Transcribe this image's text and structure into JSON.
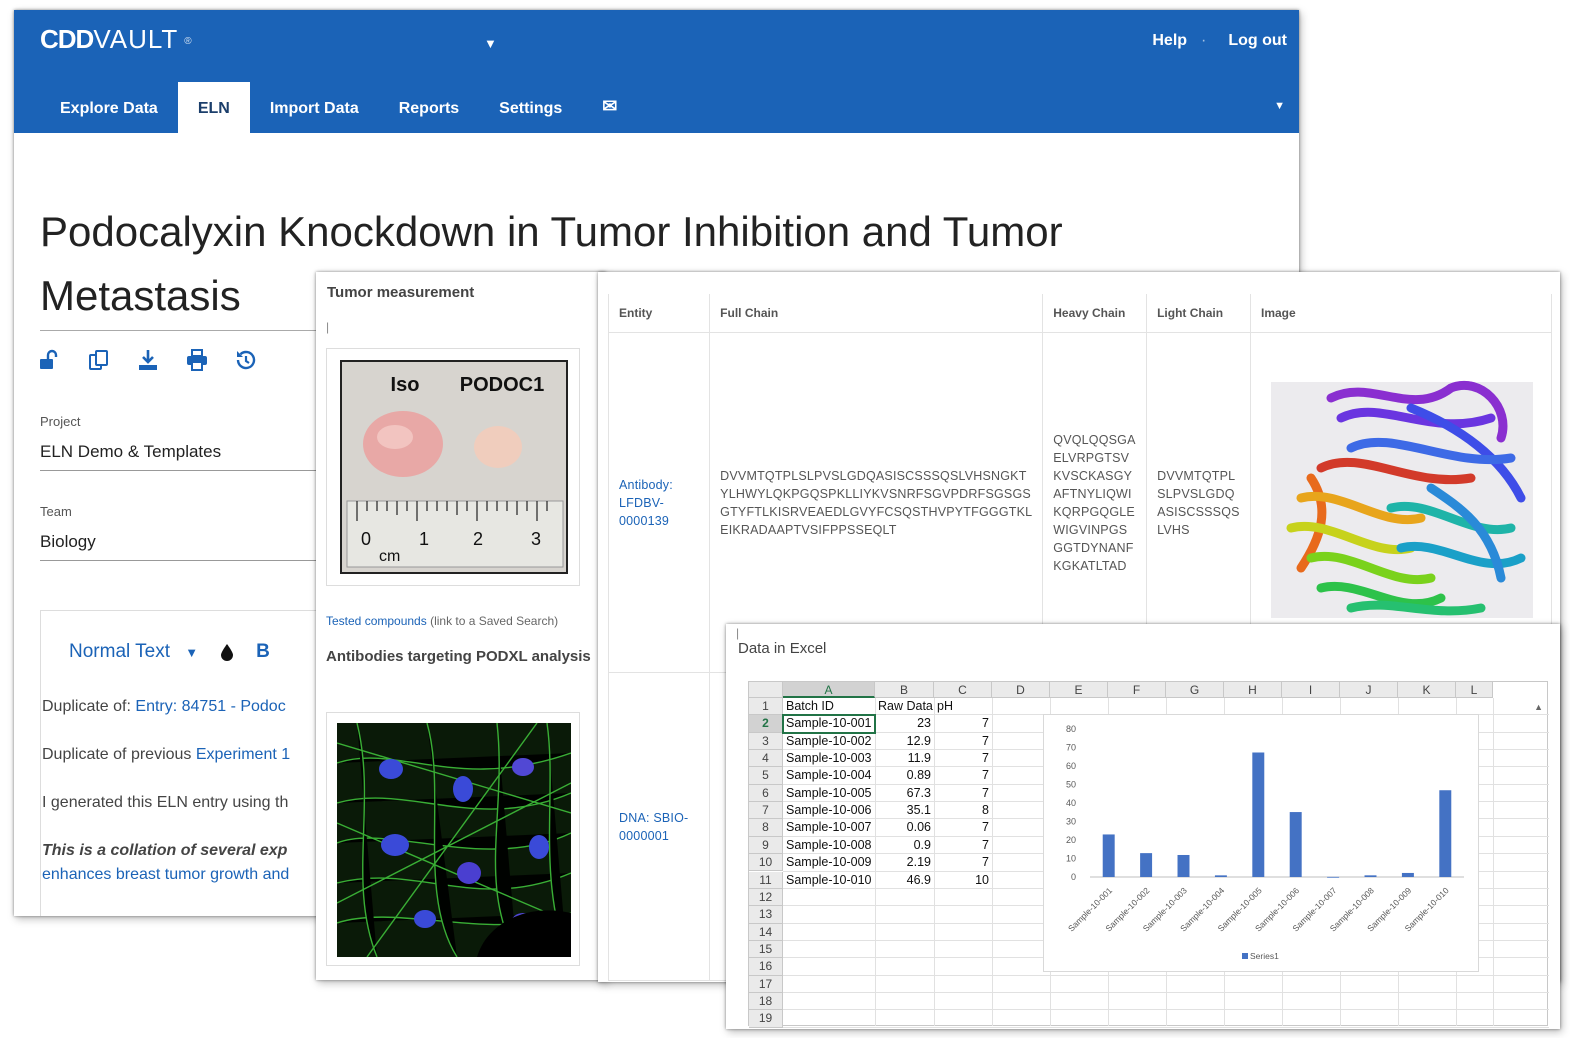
{
  "header": {
    "logo_left": "CDD",
    "logo_right": "VAULT",
    "logo_mark": "®",
    "dropdown_glyph": "▼",
    "links": {
      "help": "Help",
      "logout": "Log out"
    },
    "tabs": [
      "Explore Data",
      "ELN",
      "Import Data",
      "Reports",
      "Settings"
    ],
    "mail_glyph": "✉",
    "menu_glyph": "▼"
  },
  "entry": {
    "title": "Podocalyxin Knockdown in Tumor Inhibition and Tumor Metastasis",
    "tools": [
      "unlock-icon",
      "copy-icon",
      "download-icon",
      "print-icon",
      "history-icon"
    ],
    "project_label": "Project",
    "project_value": "ELN Demo & Templates",
    "team_label": "Team",
    "team_value": "Biology"
  },
  "editor": {
    "style_select": "Normal Text",
    "bold_label": "B",
    "line1_prefix": "Duplicate of: ",
    "line1_link": "Entry: 84751 - Podoc",
    "line2_prefix": "Duplicate of previous ",
    "line2_link": "Experiment 1",
    "line3": "I generated this ELN entry using th",
    "line4": "This is a collation of several exp",
    "line5": "enhances breast tumor growth and"
  },
  "tumor": {
    "heading": "Tumor measurement",
    "img_label_left": "Iso",
    "img_label_right": "PODOC1",
    "ruler_labels": [
      "0",
      "1",
      "2",
      "3"
    ],
    "ruler_unit": "cm",
    "link_text": "Tested compounds",
    "link_note": " (link to a Saved Search)",
    "heading2": "Antibodies targeting PODXL analysis"
  },
  "antibody": {
    "columns": [
      "Entity",
      "Full Chain",
      "Heavy Chain",
      "Light Chain",
      "Image"
    ],
    "row1": {
      "entity": "Antibody:\nLFDBV-\n0000139",
      "full_chain": "DVVMTQTPLSLPVSLGDQASISCSSSQSLVHSNGKT\nYLHWYLQKPGQSPKLLIYKVSNRFSGVPDRFSGSGS\nGTYFTLKISRVEAEDLGVYFCSQSTHVPYTFGGGTKL\nEIKRADAAPTVSIFPPSSEQLT",
      "heavy_chain": "QVQLQQSGA\nELVRPGTSV\nKVSCKASGY\nAFTNYLIQWI\nKQRPGQGLE\nWIGVINPGS\nGGTDYNANF\nKGKATLTAD",
      "light_chain": "DVVMTQTPL\nSLPVSLGDQ\nASISCSSSQS\nLVHS"
    },
    "row2": {
      "entity": "DNA: SBIO-\n0000001"
    }
  },
  "excel": {
    "title": "Data in Excel",
    "col_headers": [
      "A",
      "B",
      "C",
      "D",
      "E",
      "F",
      "G",
      "H",
      "I",
      "J",
      "K",
      "L"
    ],
    "row_numbers": [
      "1",
      "2",
      "3",
      "4",
      "5",
      "6",
      "7",
      "8",
      "9",
      "10",
      "11",
      "12",
      "13",
      "14",
      "15",
      "16",
      "17",
      "18",
      "19"
    ],
    "headers": [
      "Batch ID",
      "Raw Data",
      "pH"
    ],
    "rows": [
      [
        "Sample-10-001",
        "23",
        "7"
      ],
      [
        "Sample-10-002",
        "12.9",
        "7"
      ],
      [
        "Sample-10-003",
        "11.9",
        "7"
      ],
      [
        "Sample-10-004",
        "0.89",
        "7"
      ],
      [
        "Sample-10-005",
        "67.3",
        "7"
      ],
      [
        "Sample-10-006",
        "35.1",
        "8"
      ],
      [
        "Sample-10-007",
        "0.06",
        "7"
      ],
      [
        "Sample-10-008",
        "0.9",
        "7"
      ],
      [
        "Sample-10-009",
        "2.19",
        "7"
      ],
      [
        "Sample-10-010",
        "46.9",
        "10"
      ]
    ]
  },
  "chart_data": {
    "type": "bar",
    "categories": [
      "Sample-10-001",
      "Sample-10-002",
      "Sample-10-003",
      "Sample-10-004",
      "Sample-10-005",
      "Sample-10-006",
      "Sample-10-007",
      "Sample-10-008",
      "Sample-10-009",
      "Sample-10-010"
    ],
    "series": [
      {
        "name": "Series1",
        "values": [
          23,
          12.9,
          11.9,
          0.89,
          67.3,
          35.1,
          0.06,
          0.9,
          2.19,
          46.9
        ]
      }
    ],
    "ylim": [
      0,
      80
    ],
    "yticks": [
      0,
      10,
      20,
      30,
      40,
      50,
      60,
      70,
      80
    ],
    "legend": "bottom",
    "color": "#4472c4",
    "grid": false
  }
}
